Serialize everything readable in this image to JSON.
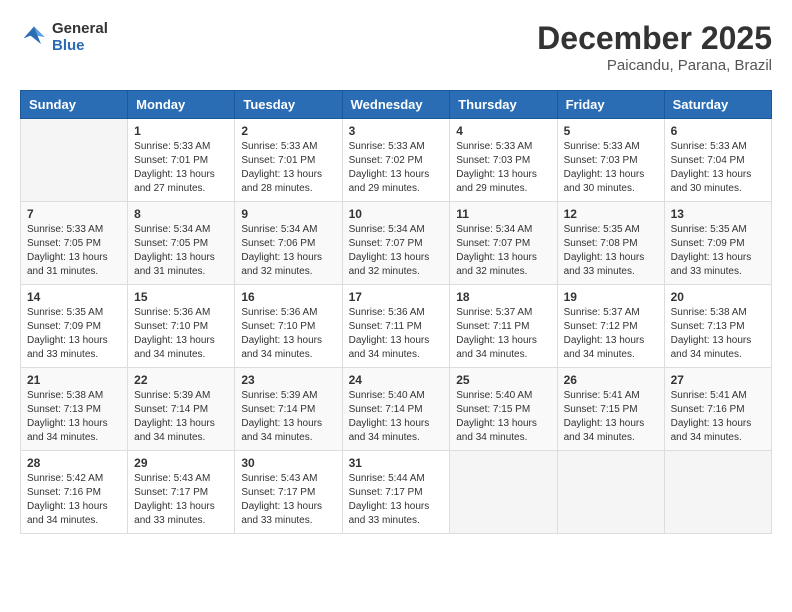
{
  "header": {
    "logo_line1": "General",
    "logo_line2": "Blue",
    "month": "December 2025",
    "location": "Paicandu, Parana, Brazil"
  },
  "weekdays": [
    "Sunday",
    "Monday",
    "Tuesday",
    "Wednesday",
    "Thursday",
    "Friday",
    "Saturday"
  ],
  "weeks": [
    [
      {
        "day": "",
        "info": ""
      },
      {
        "day": "1",
        "info": "Sunrise: 5:33 AM\nSunset: 7:01 PM\nDaylight: 13 hours\nand 27 minutes."
      },
      {
        "day": "2",
        "info": "Sunrise: 5:33 AM\nSunset: 7:01 PM\nDaylight: 13 hours\nand 28 minutes."
      },
      {
        "day": "3",
        "info": "Sunrise: 5:33 AM\nSunset: 7:02 PM\nDaylight: 13 hours\nand 29 minutes."
      },
      {
        "day": "4",
        "info": "Sunrise: 5:33 AM\nSunset: 7:03 PM\nDaylight: 13 hours\nand 29 minutes."
      },
      {
        "day": "5",
        "info": "Sunrise: 5:33 AM\nSunset: 7:03 PM\nDaylight: 13 hours\nand 30 minutes."
      },
      {
        "day": "6",
        "info": "Sunrise: 5:33 AM\nSunset: 7:04 PM\nDaylight: 13 hours\nand 30 minutes."
      }
    ],
    [
      {
        "day": "7",
        "info": "Sunrise: 5:33 AM\nSunset: 7:05 PM\nDaylight: 13 hours\nand 31 minutes."
      },
      {
        "day": "8",
        "info": "Sunrise: 5:34 AM\nSunset: 7:05 PM\nDaylight: 13 hours\nand 31 minutes."
      },
      {
        "day": "9",
        "info": "Sunrise: 5:34 AM\nSunset: 7:06 PM\nDaylight: 13 hours\nand 32 minutes."
      },
      {
        "day": "10",
        "info": "Sunrise: 5:34 AM\nSunset: 7:07 PM\nDaylight: 13 hours\nand 32 minutes."
      },
      {
        "day": "11",
        "info": "Sunrise: 5:34 AM\nSunset: 7:07 PM\nDaylight: 13 hours\nand 32 minutes."
      },
      {
        "day": "12",
        "info": "Sunrise: 5:35 AM\nSunset: 7:08 PM\nDaylight: 13 hours\nand 33 minutes."
      },
      {
        "day": "13",
        "info": "Sunrise: 5:35 AM\nSunset: 7:09 PM\nDaylight: 13 hours\nand 33 minutes."
      }
    ],
    [
      {
        "day": "14",
        "info": "Sunrise: 5:35 AM\nSunset: 7:09 PM\nDaylight: 13 hours\nand 33 minutes."
      },
      {
        "day": "15",
        "info": "Sunrise: 5:36 AM\nSunset: 7:10 PM\nDaylight: 13 hours\nand 34 minutes."
      },
      {
        "day": "16",
        "info": "Sunrise: 5:36 AM\nSunset: 7:10 PM\nDaylight: 13 hours\nand 34 minutes."
      },
      {
        "day": "17",
        "info": "Sunrise: 5:36 AM\nSunset: 7:11 PM\nDaylight: 13 hours\nand 34 minutes."
      },
      {
        "day": "18",
        "info": "Sunrise: 5:37 AM\nSunset: 7:11 PM\nDaylight: 13 hours\nand 34 minutes."
      },
      {
        "day": "19",
        "info": "Sunrise: 5:37 AM\nSunset: 7:12 PM\nDaylight: 13 hours\nand 34 minutes."
      },
      {
        "day": "20",
        "info": "Sunrise: 5:38 AM\nSunset: 7:13 PM\nDaylight: 13 hours\nand 34 minutes."
      }
    ],
    [
      {
        "day": "21",
        "info": "Sunrise: 5:38 AM\nSunset: 7:13 PM\nDaylight: 13 hours\nand 34 minutes."
      },
      {
        "day": "22",
        "info": "Sunrise: 5:39 AM\nSunset: 7:14 PM\nDaylight: 13 hours\nand 34 minutes."
      },
      {
        "day": "23",
        "info": "Sunrise: 5:39 AM\nSunset: 7:14 PM\nDaylight: 13 hours\nand 34 minutes."
      },
      {
        "day": "24",
        "info": "Sunrise: 5:40 AM\nSunset: 7:14 PM\nDaylight: 13 hours\nand 34 minutes."
      },
      {
        "day": "25",
        "info": "Sunrise: 5:40 AM\nSunset: 7:15 PM\nDaylight: 13 hours\nand 34 minutes."
      },
      {
        "day": "26",
        "info": "Sunrise: 5:41 AM\nSunset: 7:15 PM\nDaylight: 13 hours\nand 34 minutes."
      },
      {
        "day": "27",
        "info": "Sunrise: 5:41 AM\nSunset: 7:16 PM\nDaylight: 13 hours\nand 34 minutes."
      }
    ],
    [
      {
        "day": "28",
        "info": "Sunrise: 5:42 AM\nSunset: 7:16 PM\nDaylight: 13 hours\nand 34 minutes."
      },
      {
        "day": "29",
        "info": "Sunrise: 5:43 AM\nSunset: 7:17 PM\nDaylight: 13 hours\nand 33 minutes."
      },
      {
        "day": "30",
        "info": "Sunrise: 5:43 AM\nSunset: 7:17 PM\nDaylight: 13 hours\nand 33 minutes."
      },
      {
        "day": "31",
        "info": "Sunrise: 5:44 AM\nSunset: 7:17 PM\nDaylight: 13 hours\nand 33 minutes."
      },
      {
        "day": "",
        "info": ""
      },
      {
        "day": "",
        "info": ""
      },
      {
        "day": "",
        "info": ""
      }
    ]
  ]
}
